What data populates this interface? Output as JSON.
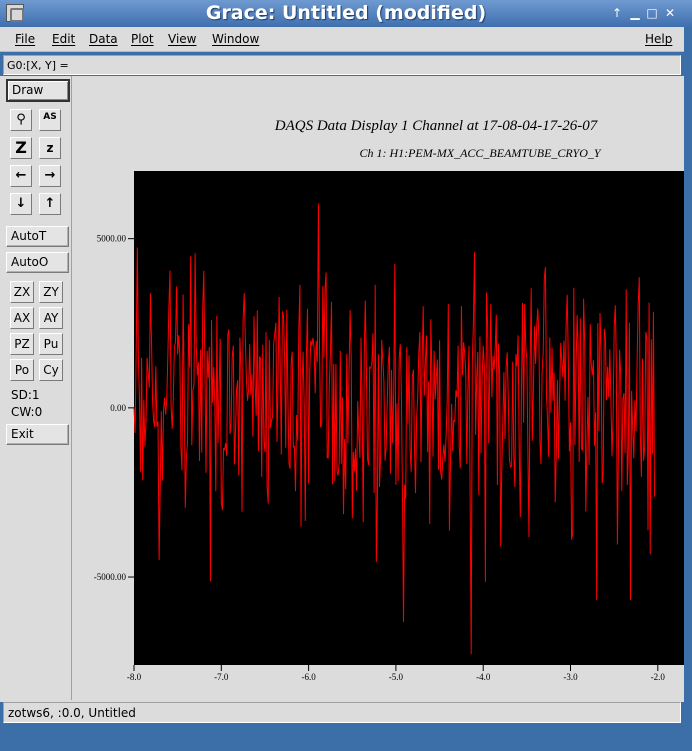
{
  "window": {
    "title": "Grace: Untitled (modified)",
    "controls": [
      "up-arrow-icon",
      "minimize-icon",
      "maximize-icon",
      "close-icon"
    ]
  },
  "menubar": {
    "items": [
      "File",
      "Edit",
      "Data",
      "Plot",
      "View",
      "Window"
    ],
    "help": "Help"
  },
  "locator": {
    "text": "G0:[X, Y] ="
  },
  "toolbar": {
    "draw": "Draw",
    "icons": [
      "zoom-magnifier-icon",
      "autoscale-text-icon",
      "zoom-in-z-icon",
      "zoom-out-z-icon",
      "left-arrow-icon",
      "right-arrow-icon",
      "down-arrow-icon",
      "up-arrow-icon"
    ],
    "icon_labels": {
      "autoscale": "AS",
      "z_big": "Z",
      "z_small": "z"
    },
    "autot": "AutoT",
    "autoo": "AutoO",
    "grid": [
      "ZX",
      "ZY",
      "AX",
      "AY",
      "PZ",
      "Pu",
      "Po",
      "Cy"
    ],
    "sd": "SD:1",
    "cw": "CW:0",
    "exit": "Exit"
  },
  "chart_data": {
    "type": "line",
    "title": "DAQS Data Display 1 Channel at 17-08-04-17-26-07",
    "subtitle": "Ch 1:  H1:PEM-MX_ACC_BEAMTUBE_CRYO_Y",
    "xlabel": "",
    "ylabel": "",
    "xlim": [
      -8.0,
      -1.7
    ],
    "ylim": [
      -7600,
      7000
    ],
    "x_ticks": [
      "-8.0",
      "-7.0",
      "-6.0",
      "-5.0",
      "-4.0",
      "-3.0",
      "-2.0"
    ],
    "y_ticks": [
      "5000.00",
      "0.00",
      "-5000.00"
    ],
    "background": "#000000",
    "series_color": "#ff0000",
    "series": [
      {
        "x_start": -8.0,
        "x_step": 0.0125,
        "values": [
          10,
          -740,
          1730,
          4740,
          1480,
          230,
          -1890,
          1480,
          -2140,
          230,
          -1140,
          -420,
          1480,
          1040,
          600,
          3390,
          1990,
          160,
          -380,
          -570,
          1230,
          -550,
          -400,
          -4500,
          -2310,
          -100,
          -2150,
          -80,
          300,
          -200,
          190,
          1470,
          2980,
          4060,
          20,
          -620,
          290,
          1810,
          1940,
          3590,
          1580,
          2150,
          1570,
          -1160,
          -1850,
          3350,
          480,
          -2950,
          -1470,
          -1020,
          2470,
          1190,
          4480,
          -1100,
          520,
          700,
          4570,
          1870,
          960,
          1350,
          -1570,
          1720,
          -1320,
          2910,
          4050,
          1230,
          -1920,
          1690,
          880,
          1800,
          -5130,
          2600,
          150,
          1210,
          160,
          -2460,
          2720,
          -1050,
          550,
          2040,
          -2790,
          -3020,
          -1210,
          -1240,
          -1040,
          -1420,
          2170,
          2320,
          -770,
          -470,
          1500,
          1840,
          -1670,
          -690,
          560,
          820,
          -2000,
          2080,
          1240,
          -3070,
          2600,
          3390,
          2090,
          880,
          210,
          510,
          1890,
          380,
          990,
          -850,
          2710,
          700,
          -230,
          2880,
          -1280,
          1520,
          1450,
          -2040,
          1860,
          -990,
          -1300,
          2240,
          -2350,
          -2830,
          2010,
          -600,
          -360,
          -270,
          1920,
          2190,
          2520,
          -1010,
          690,
          3280,
          1290,
          -1380,
          2850,
          2700,
          1510,
          -1180,
          2900,
          300,
          -1650,
          -1800,
          1310,
          1660,
          -1150,
          -1140,
          -2460,
          -210,
          -970,
          2270,
          3640,
          -3510,
          760,
          1660,
          80,
          -3340,
          1600,
          2930,
          -2240,
          1020,
          1990,
          1840,
          2070,
          1770,
          430,
          1980,
          1360,
          6040,
          1820,
          -580,
          -460,
          3600,
          1470,
          3520,
          4000,
          -1470,
          -1480,
          660,
          1610,
          3130,
          -2260,
          1300,
          -2170,
          1290,
          -1850,
          -2000,
          -1610,
          1690,
          -1650,
          310,
          -3140,
          -920,
          -2410,
          1600,
          -1050,
          960,
          2890,
          1470,
          -3270,
          -1300,
          -1880,
          -1200,
          -2450,
          200,
          -780,
          -1480,
          2070,
          250,
          -3380,
          1670,
          3170,
          1160,
          -1500,
          -1690,
          1200,
          1170,
          1340,
          2210,
          -2520,
          3640,
          -4560,
          -2680,
          1590,
          -2340,
          -1440,
          2010,
          1410,
          780,
          -1560,
          -1190,
          130,
          1300,
          1800,
          -1950,
          1120,
          -1040,
          420,
          4250,
          -2270,
          140,
          -2160,
          1460,
          1880,
          390,
          -2700,
          -6330,
          -2270,
          -2700,
          1800,
          -480,
          1550,
          -1240,
          -1890,
          920,
          1130,
          -1190,
          -2520,
          -320,
          300,
          1630,
          2240,
          -1600,
          1310,
          3000,
          360,
          1380,
          2140,
          -1310,
          780,
          -3430,
          2620,
          1080,
          -1440,
          1690,
          250,
          900,
          1430,
          -1830,
          2000,
          -1880,
          -2120,
          -1490,
          -1080,
          -1600,
          -840,
          200,
          3070,
          -3630,
          -1560,
          120,
          -1270,
          -370,
          -400,
          520,
          310,
          1840,
          -1130,
          -1790,
          3010,
          970,
          1940,
          1620,
          1080,
          -1660,
          510,
          1830,
          -2550,
          -7280,
          1340,
          2500,
          4600,
          -800,
          890,
          1650,
          -2570,
          2110,
          -1350,
          870,
          1830,
          1230,
          -5140,
          3410,
          2440,
          -1050,
          1130,
          3070,
          310,
          1540,
          1120,
          1790,
          2750,
          -2280,
          1890,
          1000,
          -4100,
          -1770,
          -470,
          1050,
          -920,
          1190,
          1640,
          280,
          -1500,
          -1750,
          -1720,
          1360,
          -1420,
          -2340,
          1590,
          1230,
          2140,
          -1170,
          -3230,
          360,
          3100,
          -440,
          3070,
          1790,
          1420,
          -1330,
          -3820,
          1180,
          3540,
          -970,
          550,
          2410,
          1300,
          2400,
          2940,
          2110,
          -1000,
          -1660,
          1050,
          1650,
          3810,
          4160,
          380,
          -400,
          -1450,
          2080,
          -140,
          1780,
          210,
          1040,
          -2790,
          -1360,
          820,
          -1510,
          380,
          1920,
          1390,
          900,
          1990,
          210,
          2440,
          3340,
          1500,
          -1290,
          -430,
          -3900,
          -3690,
          3550,
          -1100,
          1140,
          2740,
          1830,
          -1600,
          2650,
          -1190,
          -1260,
          3230,
          1930,
          -3060,
          -1100,
          320,
          -1690,
          2470,
          1310,
          960,
          1410,
          -1120,
          -130,
          -5680,
          2500,
          -680,
          2800,
          1610,
          -2230,
          -1890,
          2340,
          2060,
          230,
          1220,
          320,
          1730,
          260,
          -1430,
          -290,
          2420,
          3030,
          1400,
          -4040,
          -1040,
          1720,
          950,
          -2460,
          270,
          440,
          -1340,
          3500,
          -2280,
          -1340,
          2510,
          -5680,
          500,
          -620,
          -1490,
          220,
          -680,
          1410,
          3080,
          3860,
          -780,
          -2040,
          1450,
          -1560,
          -1150,
          2240,
          2060,
          -3620,
          3110,
          -4330,
          2030,
          -1370,
          2840,
          -2630
        ]
      }
    ]
  },
  "status": {
    "text": "zotws6, :0.0, Untitled"
  }
}
